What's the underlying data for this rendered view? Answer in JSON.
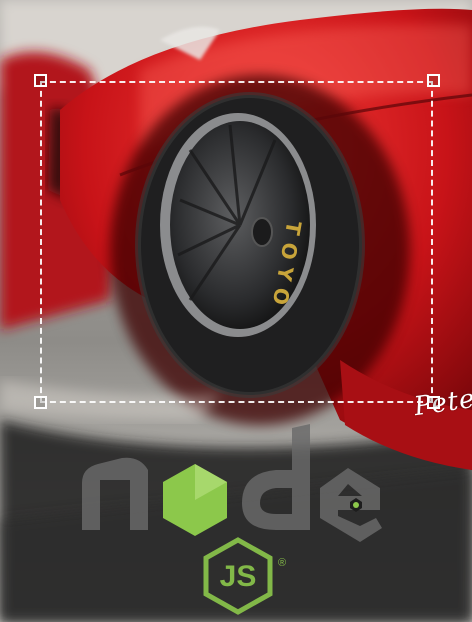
{
  "tire": {
    "brand": "TOYO"
  },
  "signature": {
    "text": "Pete"
  },
  "logo": {
    "wordmark": "node",
    "badge": "JS",
    "registered": "®"
  },
  "colors": {
    "car_red": "#c81318",
    "crop_outline": "#ffffff",
    "logo_grey": "#6a6a6a",
    "logo_green": "#8cc84b",
    "tire_text": "#c8a43a"
  },
  "icons": {
    "crop_handles": [
      "crop-handle-icon",
      "crop-handle-icon",
      "crop-handle-icon",
      "crop-handle-icon"
    ],
    "logo": "nodejs-logo-icon"
  }
}
